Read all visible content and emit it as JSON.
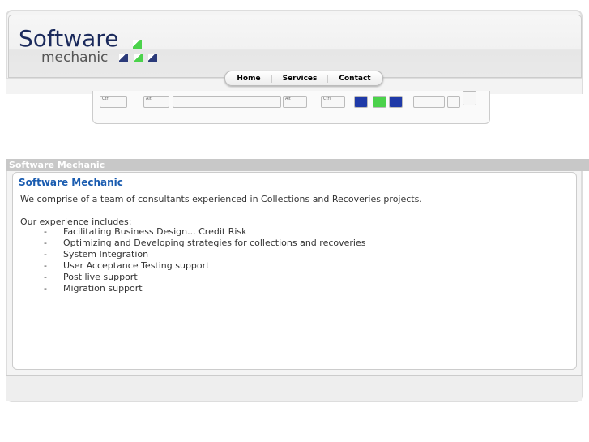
{
  "logo": {
    "text_main": "Software",
    "text_sub": "mechanic"
  },
  "nav": {
    "items": [
      "Home",
      "Services",
      "Contact"
    ]
  },
  "banner": {
    "overlay_title": "Software Mechanic"
  },
  "content": {
    "title": "Software Mechanic",
    "intro": "We comprise of a team of consultants experienced in Collections and Recoveries projects.",
    "experience_label": "Our experience includes:",
    "bullet": "-",
    "items": [
      "Facilitating Business Design... Credit Risk",
      "Optimizing and Developing strategies for collections and recoveries",
      "System Integration",
      "User Acceptance Testing support",
      "Post live support",
      "Migration support"
    ]
  },
  "colors": {
    "accent": "#1a5cb0",
    "logo": "#1b2a5c",
    "green": "#4bd24b",
    "blue": "#1f3aa8"
  }
}
